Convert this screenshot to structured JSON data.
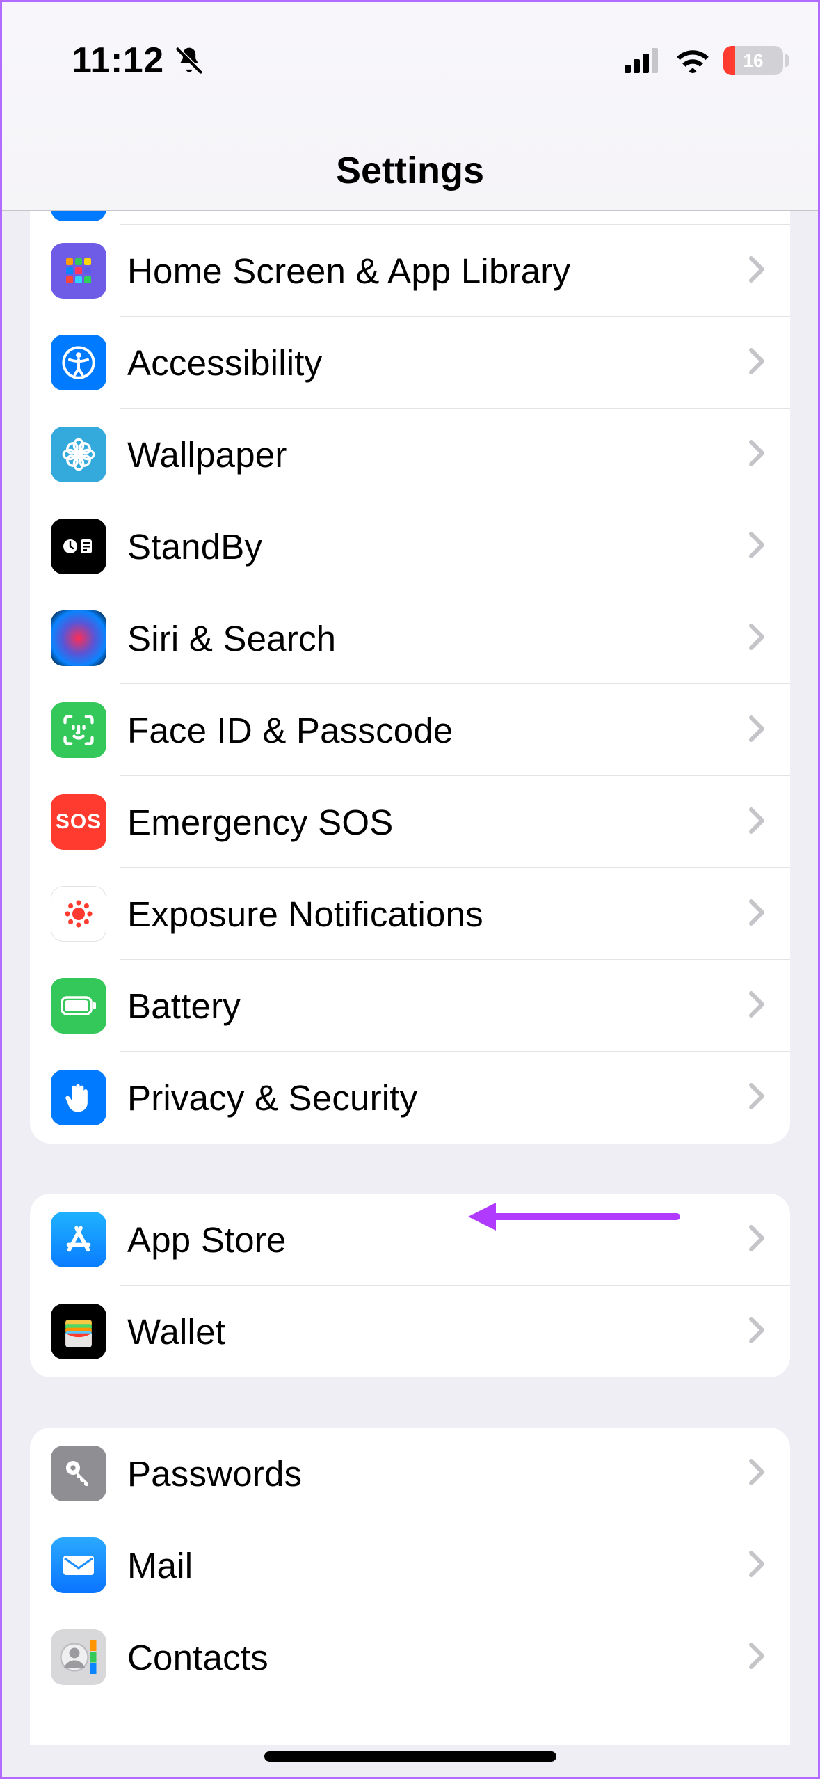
{
  "status_bar": {
    "time": "11:12",
    "silent_icon": "bell-slash-icon",
    "battery_percent": "16"
  },
  "header": {
    "title": "Settings"
  },
  "groups": [
    {
      "rows": [
        {
          "id": "peek",
          "label": "",
          "icon": "display-brightness-icon"
        },
        {
          "id": "home-screen",
          "label": "Home Screen & App Library",
          "icon": "apps-grid-icon"
        },
        {
          "id": "accessibility",
          "label": "Accessibility",
          "icon": "accessibility-icon"
        },
        {
          "id": "wallpaper",
          "label": "Wallpaper",
          "icon": "flower-icon"
        },
        {
          "id": "standby",
          "label": "StandBy",
          "icon": "clock-card-icon"
        },
        {
          "id": "siri",
          "label": "Siri & Search",
          "icon": "siri-icon"
        },
        {
          "id": "faceid",
          "label": "Face ID & Passcode",
          "icon": "faceid-icon"
        },
        {
          "id": "sos",
          "label": "Emergency SOS",
          "icon": "sos-icon"
        },
        {
          "id": "exposure",
          "label": "Exposure Notifications",
          "icon": "exposure-icon"
        },
        {
          "id": "battery",
          "label": "Battery",
          "icon": "battery-icon"
        },
        {
          "id": "privacy",
          "label": "Privacy & Security",
          "icon": "hand-icon"
        }
      ]
    },
    {
      "rows": [
        {
          "id": "appstore",
          "label": "App Store",
          "icon": "appstore-icon"
        },
        {
          "id": "wallet",
          "label": "Wallet",
          "icon": "wallet-icon"
        }
      ]
    },
    {
      "rows": [
        {
          "id": "passwords",
          "label": "Passwords",
          "icon": "key-icon"
        },
        {
          "id": "mail",
          "label": "Mail",
          "icon": "envelope-icon"
        },
        {
          "id": "contacts",
          "label": "Contacts",
          "icon": "person-circle-icon"
        }
      ]
    }
  ],
  "annotation": {
    "target_row": "privacy",
    "color": "#b03bff"
  }
}
